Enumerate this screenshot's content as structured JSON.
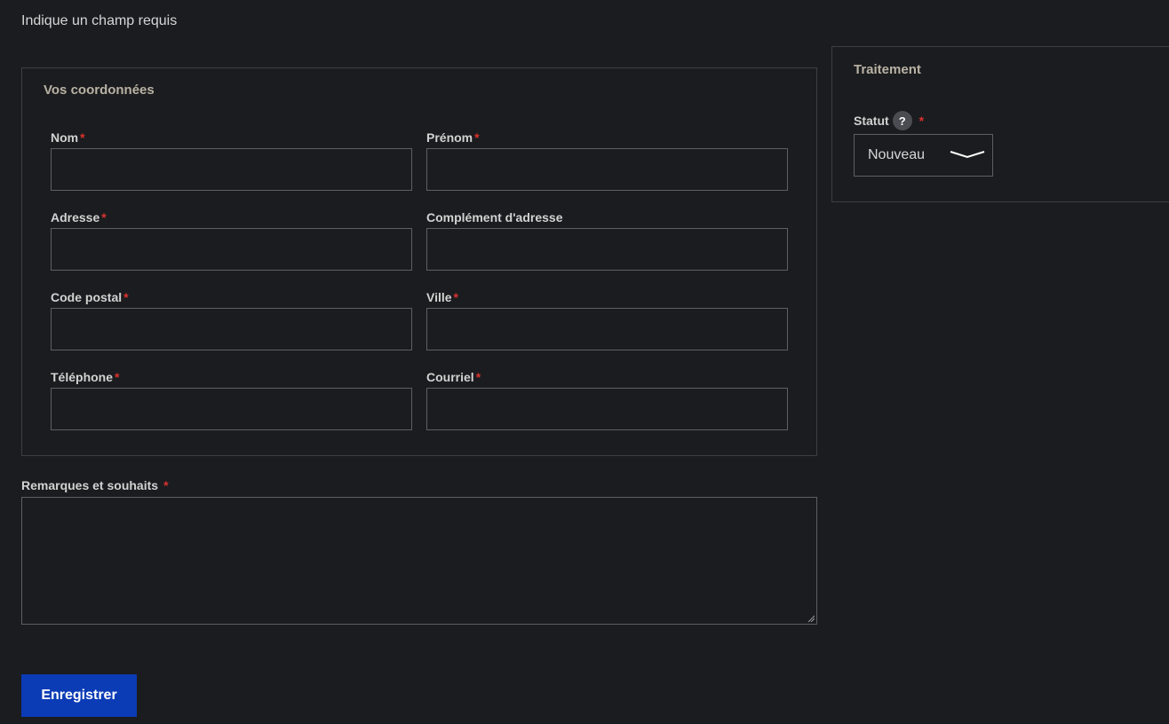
{
  "required_note": "Indique un champ requis",
  "fieldset": {
    "legend": "Vos coordonnées",
    "fields": {
      "nom": {
        "label": "Nom",
        "required": "*",
        "value": ""
      },
      "prenom": {
        "label": "Prénom",
        "required": "*",
        "value": ""
      },
      "adresse": {
        "label": "Adresse",
        "required": "*",
        "value": ""
      },
      "complement": {
        "label": "Complément d'adresse",
        "value": ""
      },
      "code_postal": {
        "label": "Code postal",
        "required": "*",
        "value": ""
      },
      "ville": {
        "label": "Ville",
        "required": "*",
        "value": ""
      },
      "telephone": {
        "label": "Téléphone",
        "required": "*",
        "value": ""
      },
      "courriel": {
        "label": "Courriel",
        "required": "*",
        "value": ""
      }
    }
  },
  "remarks": {
    "label": "Remarques et souhaits",
    "required": "*",
    "value": ""
  },
  "save_button": "Enregistrer",
  "sidebar": {
    "title": "Traitement",
    "statut": {
      "label": "Statut",
      "help": "?",
      "required": "*",
      "selected": "Nouveau"
    }
  },
  "colors": {
    "background": "#1b1c1f",
    "accent": "#0b3bb5",
    "required": "#d8322e",
    "border": "#5c5f64"
  }
}
